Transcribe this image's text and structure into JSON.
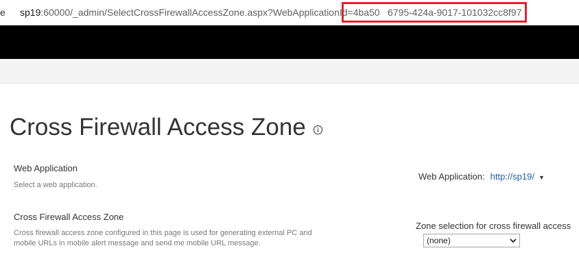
{
  "browser": {
    "address_prefix_char": "e",
    "url_host": "sp19",
    "url_rest": ":60000/_admin/SelectCrossFirewallAccessZone.aspx?WebApplicationId=4ba50",
    "url_tail": "6795-424a-9017-101032cc8f97",
    "highlight_color": "#e5202e"
  },
  "page": {
    "title": "Cross Firewall Access Zone",
    "info_icon": "info-icon"
  },
  "web_application_section": {
    "title": "Web Application",
    "description": "Select a web application.",
    "selector_label": "Web Application:",
    "selector_value": "http://sp19/"
  },
  "zone_section": {
    "title": "Cross Firewall Access Zone",
    "description": "Cross firewall access zone configured in this page is used for generating external PC and mobile URLs in mobile alert message and send me mobile URL message.",
    "selection_label": "Zone selection for cross firewall access",
    "selected_option": "(none)"
  },
  "colors": {
    "suite_bar": "#000000",
    "ribbon": "#f4f4f4",
    "link": "#1e5ea8"
  }
}
